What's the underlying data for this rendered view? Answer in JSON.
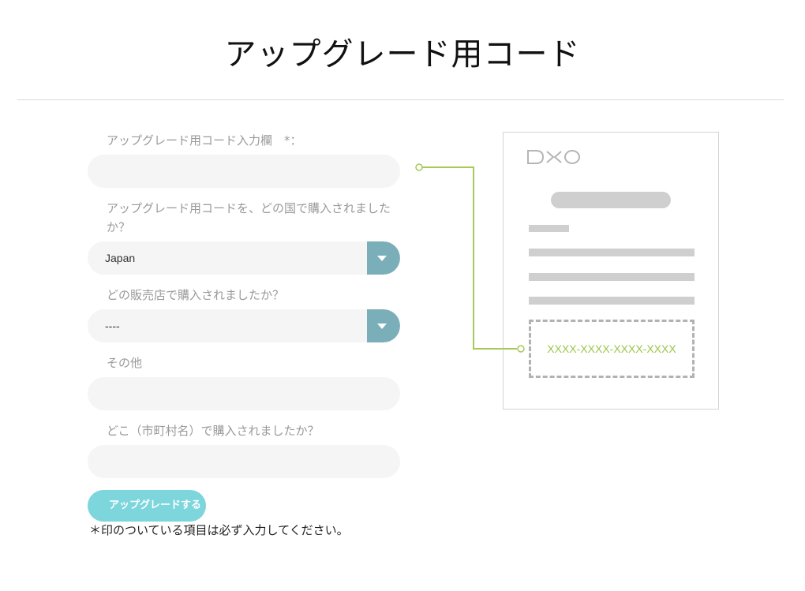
{
  "page": {
    "title": "アップグレード用コード"
  },
  "form": {
    "code_label": "アップグレード用コード入力欄　*：",
    "code_value": "",
    "country_label": "アップグレード用コードを、どの国で購入されましたか？",
    "country_value": "Japan",
    "store_label": "どの販売店で購入されましたか？",
    "store_value": "----",
    "other_label": "その他",
    "other_value": "",
    "city_label": "どこ（市町村名）で購入されましたか？",
    "city_value": "",
    "submit_label": "アップグレードする",
    "required_note": "＊印のついている項目は必ず入力してください。"
  },
  "illustration": {
    "logo_text": "DXO",
    "code_sample": "XXXX-XXXX-XXXX-XXXX"
  },
  "colors": {
    "accent_teal": "#7dd6dc",
    "select_button": "#7aaeb8",
    "code_green": "#9cc44b",
    "connector_green": "#a7c95a"
  }
}
